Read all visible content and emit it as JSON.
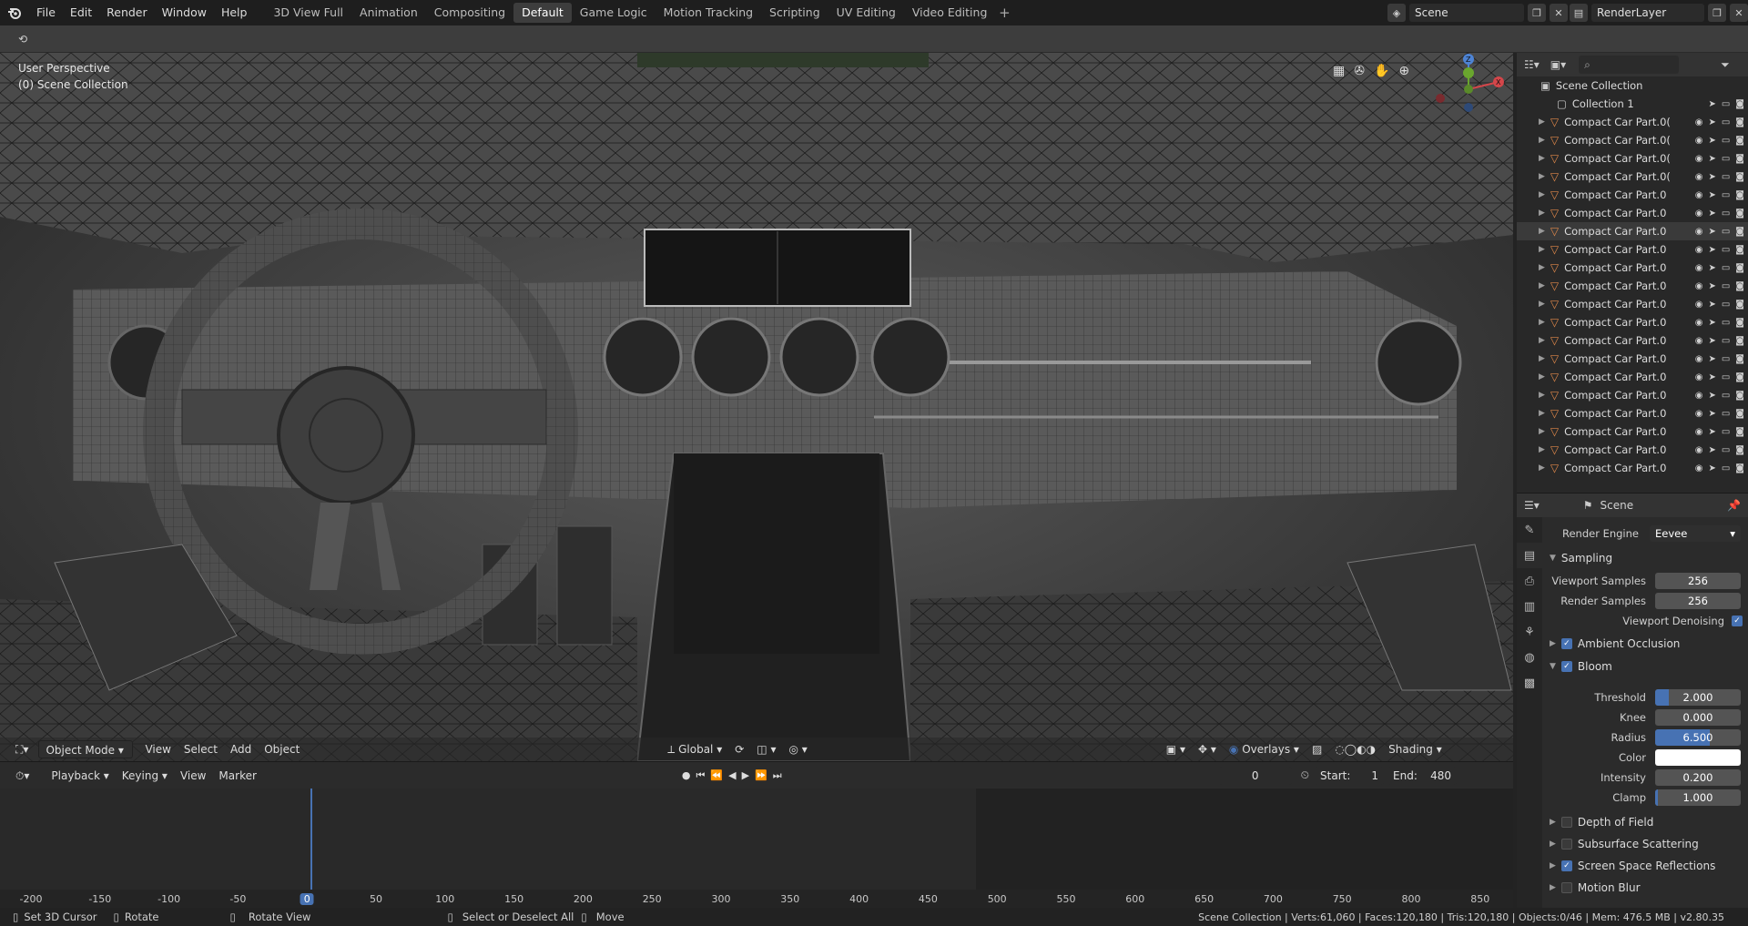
{
  "menu": {
    "file": "File",
    "edit": "Edit",
    "render": "Render",
    "window": "Window",
    "help": "Help"
  },
  "workspaces": [
    "3D View Full",
    "Animation",
    "Compositing",
    "Default",
    "Game Logic",
    "Motion Tracking",
    "Scripting",
    "UV Editing",
    "Video Editing"
  ],
  "active_workspace": "Default",
  "scene": {
    "name": "Scene",
    "layer": "RenderLayer"
  },
  "viewport": {
    "perspective": "User Perspective",
    "collection": "(0) Scene Collection"
  },
  "vp_header": {
    "mode": "Object Mode",
    "view": "View",
    "select": "Select",
    "add": "Add",
    "object": "Object",
    "orientation": "Global",
    "overlays": "Overlays",
    "shading": "Shading"
  },
  "timeline_header": {
    "playback": "Playback",
    "keying": "Keying",
    "view": "View",
    "marker": "Marker",
    "current_frame": "0",
    "start_label": "Start:",
    "start": "1",
    "end_label": "End:",
    "end": "480"
  },
  "ruler_ticks": [
    "-200",
    "-150",
    "-100",
    "-50",
    "0",
    "50",
    "100",
    "150",
    "200",
    "250",
    "300",
    "350",
    "400",
    "450",
    "500",
    "550",
    "600",
    "650",
    "700",
    "750",
    "800",
    "850"
  ],
  "outliner": {
    "root": "Scene Collection",
    "collection": "Collection 1",
    "items": [
      "Compact Car Part.0(",
      "Compact Car Part.0(",
      "Compact Car Part.0(",
      "Compact Car Part.0(",
      "Compact Car Part.0",
      "Compact Car Part.0",
      "Compact Car Part.0",
      "Compact Car Part.0",
      "Compact Car Part.0",
      "Compact Car Part.0",
      "Compact Car Part.0",
      "Compact Car Part.0",
      "Compact Car Part.0",
      "Compact Car Part.0",
      "Compact Car Part.0",
      "Compact Car Part.0",
      "Compact Car Part.0",
      "Compact Car Part.0",
      "Compact Car Part.0",
      "Compact Car Part.0"
    ]
  },
  "properties": {
    "context": "Scene",
    "render_engine_label": "Render Engine",
    "render_engine": "Eevee",
    "sampling": "Sampling",
    "viewport_samples_label": "Viewport Samples",
    "viewport_samples": "256",
    "render_samples_label": "Render Samples",
    "render_samples": "256",
    "viewport_denoising": "Viewport Denoising",
    "ambient_occlusion": "Ambient Occlusion",
    "bloom": "Bloom",
    "threshold_label": "Threshold",
    "threshold": "2.000",
    "knee_label": "Knee",
    "knee": "0.000",
    "radius_label": "Radius",
    "radius": "6.500",
    "color_label": "Color",
    "intensity_label": "Intensity",
    "intensity": "0.200",
    "clamp_label": "Clamp",
    "clamp": "1.000",
    "depth_of_field": "Depth of Field",
    "subsurface": "Subsurface Scattering",
    "ssr": "Screen Space Reflections",
    "motion_blur": "Motion Blur"
  },
  "status": {
    "cursor": "Set 3D Cursor",
    "rotate": "Rotate",
    "rotate_view": "Rotate View",
    "select": "Select or Deselect All",
    "move": "Move",
    "stats": "Scene Collection | Verts:61,060 | Faces:120,180 | Tris:120,180 | Objects:0/46 | Mem: 476.5 MB | v2.80.35"
  },
  "colors": {
    "accent": "#4772b3",
    "object_icon": "#e0884a"
  }
}
